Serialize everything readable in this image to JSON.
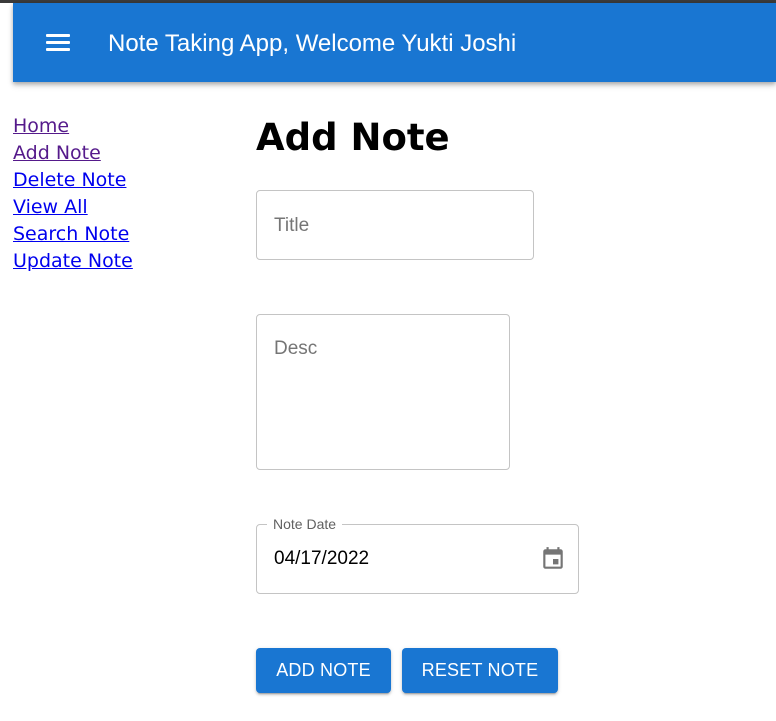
{
  "appbar": {
    "title": "Note Taking App, Welcome Yukti Joshi",
    "menu_icon": "menu-icon"
  },
  "sidebar": {
    "items": [
      {
        "label": "Home",
        "visited": true
      },
      {
        "label": "Add Note",
        "visited": true
      },
      {
        "label": "Delete Note",
        "visited": false
      },
      {
        "label": "View All",
        "visited": false
      },
      {
        "label": "Search Note",
        "visited": false
      },
      {
        "label": "Update Note",
        "visited": false
      }
    ]
  },
  "main": {
    "heading": "Add Note",
    "title_field": {
      "placeholder": "Title",
      "value": ""
    },
    "desc_field": {
      "placeholder": "Desc",
      "value": ""
    },
    "date_field": {
      "label": "Note Date",
      "value": "04/17/2022",
      "icon": "calendar-icon"
    },
    "add_button": "ADD NOTE",
    "reset_button": "RESET NOTE"
  },
  "colors": {
    "primary": "#1976d2",
    "link": "#0000ee",
    "link_visited": "#551a8b"
  }
}
